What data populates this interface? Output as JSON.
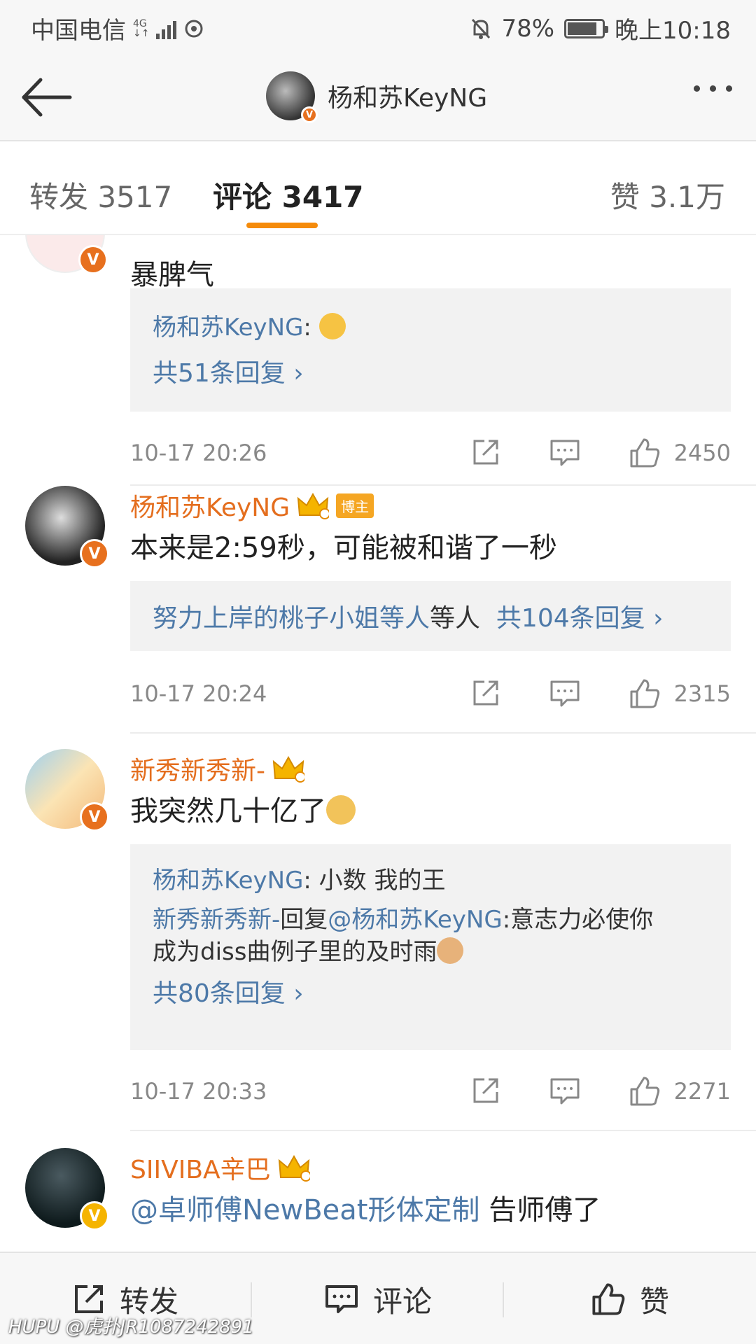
{
  "status_bar": {
    "carrier": "中国电信",
    "network": "4G",
    "battery": "78%",
    "time": "晚上10:18"
  },
  "header": {
    "title": "杨和苏KeyNG"
  },
  "tabs": {
    "repost": "转发 3517",
    "comment": "评论 3417",
    "like": "赞 3.1万"
  },
  "comments": [
    {
      "text": "暴脾气",
      "reply_author": "杨和苏KeyNG",
      "more_replies": "共51条回复 ›",
      "time": "10-17 20:26",
      "likes": "2450"
    },
    {
      "name": "杨和苏KeyNG",
      "tag": "博主",
      "text": "本来是2:59秒，可能被和谐了一秒",
      "replies_summary_names": "努力上岸的桃子小姐等人",
      "more_replies": "共104条回复 ›",
      "time": "10-17 20:24",
      "likes": "2315"
    },
    {
      "name": "新秀新秀新-",
      "text": "我突然几十亿了",
      "reply1_author": "杨和苏KeyNG",
      "reply1_text": ": 小数 我的王",
      "reply2_author": "新秀新秀新-",
      "reply2_mid": "回复",
      "reply2_mention": "@杨和苏KeyNG",
      "reply2_text_a": ":意志力必使你",
      "reply2_text_b": "成为diss曲例子里的及时雨",
      "more_replies": "共80条回复 ›",
      "time": "10-17 20:33",
      "likes": "2271"
    },
    {
      "name": "SIIVIBA辛巴",
      "mention": "@卓师傅NewBeat形体定制",
      "text": " 告师傅了"
    }
  ],
  "bottom_bar": {
    "repost": "转发",
    "comment": "评论",
    "like": "赞"
  },
  "watermark": "HUPU @虎扑JR1087242891",
  "icons": {
    "back": "back-arrow-icon",
    "more": "more-dots-icon",
    "repost": "repost-icon",
    "comment": "comment-icon",
    "like": "thumbs-up-icon",
    "verified": "verified-v-icon",
    "crown": "crown-icon"
  },
  "colors": {
    "accent": "#f58b0b",
    "username": "#e46e1e",
    "link": "#4d79a8",
    "reply_bg": "#f2f2f2"
  }
}
